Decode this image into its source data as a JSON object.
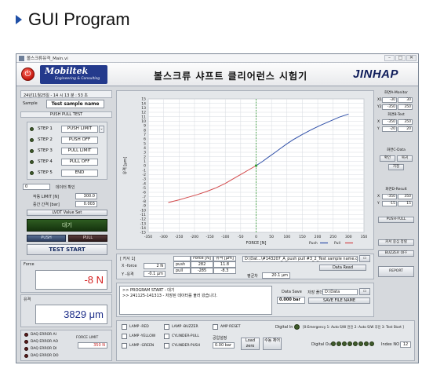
{
  "heading": {
    "title": "GUI Program"
  },
  "window": {
    "title": "볼스크류유격_Main.vi",
    "brand": {
      "logo_name": "Mobiltek",
      "logo_sub": "Engineering & Consulting"
    },
    "main_title": "볼스크류 샤프트 클리어런스 시험기",
    "company": "JINHAP"
  },
  "left": {
    "datetime": "24년11월25일 - 14 시 13 분 : 53 초",
    "sample_label": "Sample",
    "sample_value": "Test sample name",
    "mode": "PUSH PULL TEST",
    "steps": [
      {
        "name": "STEP 1",
        "value": "PUSH LIMIT"
      },
      {
        "name": "STEP 2",
        "value": "PUSH OFF"
      },
      {
        "name": "STEP 3",
        "value": "PULL LIMIT"
      },
      {
        "name": "STEP 4",
        "value": "PULL OFF"
      },
      {
        "name": "STEP 5",
        "value": "END"
      }
    ],
    "zero_field": "0",
    "data_check": "데이터 확인",
    "limit_label": "작동 LIMIT [N]",
    "limit_value": "300.0",
    "gap_label": "중간 간격 [bar]",
    "gap_value": "0.003",
    "lvdt_button": "LVDT Value Set",
    "status_bar": "대기",
    "small_btn1": "PUSH",
    "small_btn2": "PULL",
    "test_start": "TEST START",
    "force_label": "Force",
    "force_value": "-8 N",
    "disp_label": "유격",
    "disp_value": "3829 μm",
    "daq_errors": [
      "DAQ ERROR AI",
      "DAQ ERROR AO",
      "DAQ ERROR DI",
      "DAQ ERROR DO"
    ],
    "force_limit_label": "FORCE LIMIT",
    "force_limit_value": "350 N"
  },
  "chart_data": {
    "type": "line",
    "title": "",
    "xlabel": "FORCE [N]",
    "ylabel": "유격 [μm]",
    "xlim": [
      -350,
      350
    ],
    "ylim": [
      -15,
      15
    ],
    "xticks": [
      -350,
      -300,
      -250,
      -200,
      -150,
      -100,
      -50,
      0,
      50,
      100,
      150,
      200,
      250,
      300,
      350
    ],
    "yticks": [
      -15,
      -14,
      -13,
      -12,
      -11,
      -10,
      -9,
      -8,
      -7,
      -6,
      -5,
      -4,
      -3,
      -2,
      -1,
      0,
      1,
      2,
      3,
      4,
      5,
      6,
      7,
      8,
      9,
      10,
      11,
      12,
      13,
      14,
      15
    ],
    "grid": true,
    "vline_x": 0,
    "legend": [
      "Push",
      "Pull"
    ],
    "series": [
      {
        "name": "Push",
        "color": "#2f4fa8",
        "x": [
          0,
          20,
          40,
          60,
          80,
          100,
          120,
          150,
          180,
          210,
          240,
          270,
          300
        ],
        "y": [
          0.0,
          0.9,
          1.9,
          2.9,
          3.9,
          4.9,
          5.8,
          7.0,
          8.1,
          9.1,
          10.0,
          10.9,
          11.6
        ]
      },
      {
        "name": "Pull",
        "color": "#d2484a",
        "x": [
          0,
          -20,
          -40,
          -60,
          -80,
          -100,
          -130,
          -160,
          -190,
          -220,
          -250,
          -285
        ],
        "y": [
          0.0,
          -0.8,
          -1.6,
          -2.4,
          -3.2,
          -4.0,
          -5.0,
          -5.8,
          -6.5,
          -7.1,
          -7.7,
          -8.3
        ]
      }
    ]
  },
  "cursor": {
    "header": "[ 커서 1]",
    "xforce_label": "X -force",
    "xforce_value": "2 N",
    "ygap_label": "Y -유격",
    "ygap_value": "-0.1 μm",
    "table_head": [
      "",
      "Force [N]",
      "유격 [μm]"
    ],
    "push_row": [
      "push",
      "282",
      "11.8"
    ],
    "pull_row": [
      "pull",
      "-285",
      "-8.3"
    ],
    "file_path": "D:\\Dat...\\#143207_A_push pull #3_2_Test sample name.csv",
    "data_read": "Data Read",
    "avg_label": "평균차",
    "avg_value": "20.1 μm"
  },
  "log": {
    "lines": [
      ">> PROGRAM START - 대기",
      ">> 241125-141313 - 저장된 데이터를 불러 왔습니다."
    ],
    "data_save_label": "Data Save",
    "data_save_value": "0.000 bar",
    "save_path_label": "저장 폴더",
    "save_path_value": "D:\\Data",
    "save_file_name": "SAVE FILE NAME"
  },
  "bottom": {
    "lamps": [
      "LAMP -RED",
      "LAMP -YELLOW",
      "LAMP -GREEN",
      "LAMP -BUZZER",
      "CYLINDER-PULL",
      "CYLINDER-PUSH",
      "AMP RESET"
    ],
    "pressure_label": "공압설정",
    "pressure_value": "0.00 bar",
    "load_zero": "Load zero",
    "manual_control": "수동 제어",
    "digital_in_label": "Digital In",
    "digital_in_text": "[0:Emergency 1: Auto S/W 전진 2: Auto S/W 후진 3: Test Start ]",
    "digital_out_label": "Digital Out",
    "index_label": "Index NO",
    "index_value": "12"
  },
  "right": {
    "monitorA": "화면A-Monitor",
    "monitorA_rows": [
      [
        "X1",
        "-30",
        "30"
      ],
      [
        "Y2",
        "-350",
        "350"
      ]
    ],
    "testB": "화면B-Test",
    "testB_rows": [
      [
        "X",
        "-350",
        "350"
      ],
      [
        "Y",
        "-20",
        "20"
      ]
    ],
    "dataC": "화면C-Data",
    "dataC_btns": [
      "확인",
      "복귀",
      "지정"
    ],
    "resultD": "화면D-Result",
    "resultD_rows": [
      [
        "X",
        "-350",
        "350"
      ],
      [
        "Y",
        "-15",
        "15"
      ]
    ],
    "push_full": "PUSH-FULL",
    "cursor_fix": "커서 중심 정렬",
    "buzzer_off": "BUZZER OFF",
    "report": "REPORT"
  }
}
